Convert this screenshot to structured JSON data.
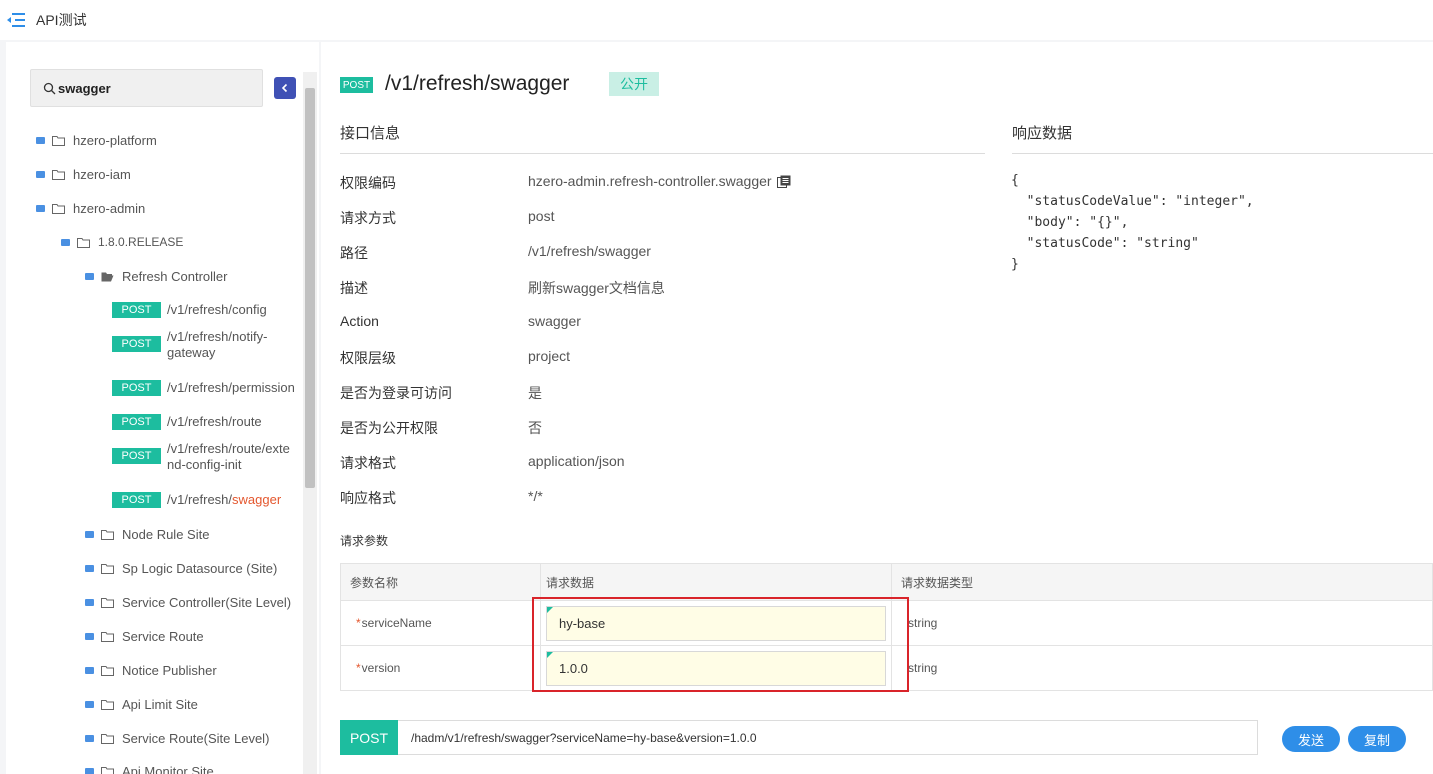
{
  "topbar": {
    "title": "API测试"
  },
  "sidebar": {
    "search_value": "swagger",
    "tree": [
      {
        "label": "hzero-platform"
      },
      {
        "label": "hzero-iam"
      },
      {
        "label": "hzero-admin"
      },
      {
        "label": "1.8.0.RELEASE"
      },
      {
        "label": "Refresh Controller"
      },
      {
        "label": "Node Rule Site"
      },
      {
        "label": "Sp Logic Datasource (Site)"
      },
      {
        "label": "Service Controller(Site Level)"
      },
      {
        "label": "Service Route"
      },
      {
        "label": "Notice Publisher"
      },
      {
        "label": "Api Limit Site"
      },
      {
        "label": "Service Route(Site Level)"
      },
      {
        "label": "Api Monitor Site"
      }
    ],
    "apis": [
      {
        "method": "POST",
        "line1": "/v1/refresh/config",
        "line2": ""
      },
      {
        "method": "POST",
        "line1": "/v1/refresh/notify-",
        "line2": "gateway"
      },
      {
        "method": "POST",
        "line1": "/v1/refresh/permission",
        "line2": ""
      },
      {
        "method": "POST",
        "line1": "/v1/refresh/route",
        "line2": ""
      },
      {
        "method": "POST",
        "line1": "/v1/refresh/route/exte",
        "line2": "nd-config-init"
      },
      {
        "method": "POST",
        "line1": "/v1/refresh/",
        "highlight": "swagger",
        "line2": ""
      }
    ]
  },
  "detail": {
    "method": "POST",
    "path": "/v1/refresh/swagger",
    "public_badge": "公开",
    "info_title": "接口信息",
    "response_title": "响应数据",
    "info": [
      {
        "label": "权限编码",
        "value": "hzero-admin.refresh-controller.swagger"
      },
      {
        "label": "请求方式",
        "value": "post"
      },
      {
        "label": "路径",
        "value": "/v1/refresh/swagger"
      },
      {
        "label": "描述",
        "value": "刷新swagger文档信息"
      },
      {
        "label": "Action",
        "value": "swagger"
      },
      {
        "label": "权限层级",
        "value": "project"
      },
      {
        "label": "是否为登录可访问",
        "value": "是"
      },
      {
        "label": "是否为公开权限",
        "value": "否"
      },
      {
        "label": "请求格式",
        "value": "application/json"
      },
      {
        "label": "响应格式",
        "value": "*/*"
      }
    ],
    "response_json": "{\n  \"statusCodeValue\": \"integer\",\n  \"body\": \"{}\",\n  \"statusCode\": \"string\"\n}",
    "params_title": "请求参数",
    "params_headers": [
      "参数名称",
      "请求数据",
      "请求数据类型"
    ],
    "params": [
      {
        "name": "serviceName",
        "value": "hy-base",
        "type": "string",
        "required": "*"
      },
      {
        "name": "version",
        "value": "1.0.0",
        "type": "string",
        "required": "*"
      }
    ],
    "request": {
      "method": "POST",
      "url": "/hadm/v1/refresh/swagger?serviceName=hy-base&version=1.0.0",
      "send_label": "发送",
      "copy_label": "复制"
    }
  }
}
